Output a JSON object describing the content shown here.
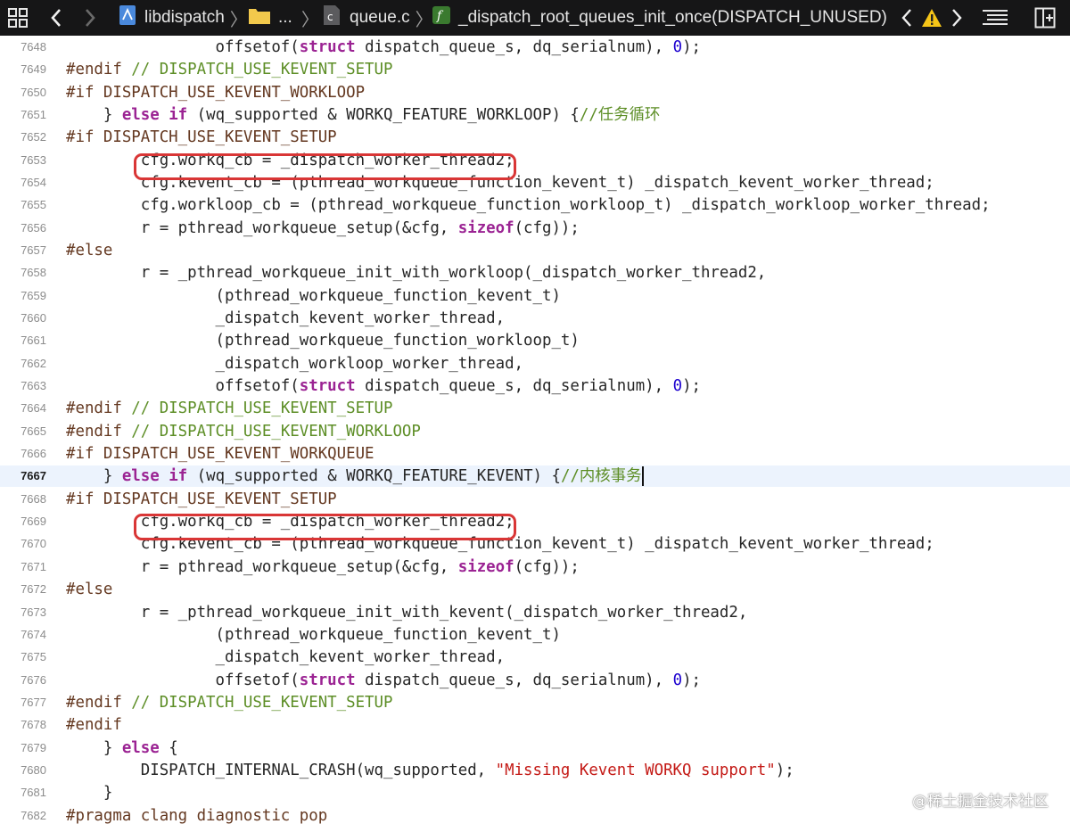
{
  "jumpbar": {
    "project": "libdispatch",
    "folder": "...",
    "file": "queue.c",
    "function": "_dispatch_root_queues_init_once(DISPATCH_UNUSED)",
    "icons": [
      "grid-icon",
      "back-chevron-icon",
      "forward-chevron-icon",
      "project-icon",
      "folder-icon",
      "c-file-icon",
      "function-icon",
      "issue-prev-icon",
      "warning-icon",
      "issue-next-icon",
      "editor-options-icon",
      "add-editor-icon"
    ],
    "colors": {
      "bar_bg": "#161617",
      "warning": "#f5c518",
      "function_badge": "#3a7a2f"
    }
  },
  "editor": {
    "current_line": "7667",
    "colors": {
      "keyword": "#9b2393",
      "comment": "#5d8e26",
      "string": "#c41a16",
      "number": "#1c00cf",
      "current_line_bg": "#ecf3fd",
      "highlight_box": "#d93636"
    },
    "lines": [
      {
        "n": "7648",
        "tokens": [
          {
            "t": "                offsetof("
          },
          {
            "t": "struct",
            "c": "kw"
          },
          {
            "t": " dispatch_queue_s, dq_serialnum), "
          },
          {
            "t": "0",
            "c": "num"
          },
          {
            "t": ");"
          }
        ]
      },
      {
        "n": "7649",
        "tokens": [
          {
            "t": "#endif ",
            "c": "pp"
          },
          {
            "t": "// DISPATCH_USE_KEVENT_SETUP",
            "c": "cm"
          }
        ]
      },
      {
        "n": "7650",
        "tokens": [
          {
            "t": "#if DISPATCH_USE_KEVENT_WORKLOOP",
            "c": "pp"
          }
        ]
      },
      {
        "n": "7651",
        "tokens": [
          {
            "t": "    } "
          },
          {
            "t": "else",
            "c": "kw"
          },
          {
            "t": " "
          },
          {
            "t": "if",
            "c": "kw"
          },
          {
            "t": " (wq_supported & WORKQ_FEATURE_WORKLOOP) {"
          },
          {
            "t": "//任务循环",
            "c": "cm"
          }
        ]
      },
      {
        "n": "7652",
        "tokens": [
          {
            "t": "#if DISPATCH_USE_KEVENT_SETUP",
            "c": "pp"
          }
        ]
      },
      {
        "n": "7653",
        "tokens": [
          {
            "t": "        cfg.workq_cb = _dispatch_worker_thread2;"
          }
        ]
      },
      {
        "n": "7654",
        "tokens": [
          {
            "t": "        cfg.kevent_cb = (pthread_workqueue_function_kevent_t) _dispatch_kevent_worker_thread;"
          }
        ]
      },
      {
        "n": "7655",
        "tokens": [
          {
            "t": "        cfg.workloop_cb = (pthread_workqueue_function_workloop_t) _dispatch_workloop_worker_thread;"
          }
        ]
      },
      {
        "n": "7656",
        "tokens": [
          {
            "t": "        r = pthread_workqueue_setup(&cfg, "
          },
          {
            "t": "sizeof",
            "c": "kw"
          },
          {
            "t": "(cfg));"
          }
        ]
      },
      {
        "n": "7657",
        "tokens": [
          {
            "t": "#else",
            "c": "pp"
          }
        ]
      },
      {
        "n": "7658",
        "tokens": [
          {
            "t": "        r = _pthread_workqueue_init_with_workloop(_dispatch_worker_thread2,"
          }
        ]
      },
      {
        "n": "7659",
        "tokens": [
          {
            "t": "                (pthread_workqueue_function_kevent_t)"
          }
        ]
      },
      {
        "n": "7660",
        "tokens": [
          {
            "t": "                _dispatch_kevent_worker_thread,"
          }
        ]
      },
      {
        "n": "7661",
        "tokens": [
          {
            "t": "                (pthread_workqueue_function_workloop_t)"
          }
        ]
      },
      {
        "n": "7662",
        "tokens": [
          {
            "t": "                _dispatch_workloop_worker_thread,"
          }
        ]
      },
      {
        "n": "7663",
        "tokens": [
          {
            "t": "                offsetof("
          },
          {
            "t": "struct",
            "c": "kw"
          },
          {
            "t": " dispatch_queue_s, dq_serialnum), "
          },
          {
            "t": "0",
            "c": "num"
          },
          {
            "t": ");"
          }
        ]
      },
      {
        "n": "7664",
        "tokens": [
          {
            "t": "#endif ",
            "c": "pp"
          },
          {
            "t": "// DISPATCH_USE_KEVENT_SETUP",
            "c": "cm"
          }
        ]
      },
      {
        "n": "7665",
        "tokens": [
          {
            "t": "#endif ",
            "c": "pp"
          },
          {
            "t": "// DISPATCH_USE_KEVENT_WORKLOOP",
            "c": "cm"
          }
        ]
      },
      {
        "n": "7666",
        "tokens": [
          {
            "t": "#if DISPATCH_USE_KEVENT_WORKQUEUE",
            "c": "pp"
          }
        ]
      },
      {
        "n": "7667",
        "tokens": [
          {
            "t": "    } "
          },
          {
            "t": "else",
            "c": "kw"
          },
          {
            "t": " "
          },
          {
            "t": "if",
            "c": "kw"
          },
          {
            "t": " (wq_supported & WORKQ_FEATURE_KEVENT) {"
          },
          {
            "t": "//内核事务",
            "c": "cm"
          }
        ]
      },
      {
        "n": "7668",
        "tokens": [
          {
            "t": "#if DISPATCH_USE_KEVENT_SETUP",
            "c": "pp"
          }
        ]
      },
      {
        "n": "7669",
        "tokens": [
          {
            "t": "        cfg.workq_cb = _dispatch_worker_thread2;"
          }
        ]
      },
      {
        "n": "7670",
        "tokens": [
          {
            "t": "        cfg.kevent_cb = (pthread_workqueue_function_kevent_t) _dispatch_kevent_worker_thread;"
          }
        ]
      },
      {
        "n": "7671",
        "tokens": [
          {
            "t": "        r = pthread_workqueue_setup(&cfg, "
          },
          {
            "t": "sizeof",
            "c": "kw"
          },
          {
            "t": "(cfg));"
          }
        ]
      },
      {
        "n": "7672",
        "tokens": [
          {
            "t": "#else",
            "c": "pp"
          }
        ]
      },
      {
        "n": "7673",
        "tokens": [
          {
            "t": "        r = _pthread_workqueue_init_with_kevent(_dispatch_worker_thread2,"
          }
        ]
      },
      {
        "n": "7674",
        "tokens": [
          {
            "t": "                (pthread_workqueue_function_kevent_t)"
          }
        ]
      },
      {
        "n": "7675",
        "tokens": [
          {
            "t": "                _dispatch_kevent_worker_thread,"
          }
        ]
      },
      {
        "n": "7676",
        "tokens": [
          {
            "t": "                offsetof("
          },
          {
            "t": "struct",
            "c": "kw"
          },
          {
            "t": " dispatch_queue_s, dq_serialnum), "
          },
          {
            "t": "0",
            "c": "num"
          },
          {
            "t": ");"
          }
        ]
      },
      {
        "n": "7677",
        "tokens": [
          {
            "t": "#endif ",
            "c": "pp"
          },
          {
            "t": "// DISPATCH_USE_KEVENT_SETUP",
            "c": "cm"
          }
        ]
      },
      {
        "n": "7678",
        "tokens": [
          {
            "t": "#endif",
            "c": "pp"
          }
        ]
      },
      {
        "n": "7679",
        "tokens": [
          {
            "t": "    } "
          },
          {
            "t": "else",
            "c": "kw"
          },
          {
            "t": " {"
          }
        ]
      },
      {
        "n": "7680",
        "tokens": [
          {
            "t": "        DISPATCH_INTERNAL_CRASH(wq_supported, "
          },
          {
            "t": "\"Missing Kevent WORKQ support\"",
            "c": "str"
          },
          {
            "t": ");"
          }
        ]
      },
      {
        "n": "7681",
        "tokens": [
          {
            "t": "    }"
          }
        ]
      },
      {
        "n": "7682",
        "tokens": [
          {
            "t": "#pragma clang diagnostic pop",
            "c": "pp"
          }
        ]
      }
    ]
  },
  "watermark": "@稀土掘金技术社区"
}
